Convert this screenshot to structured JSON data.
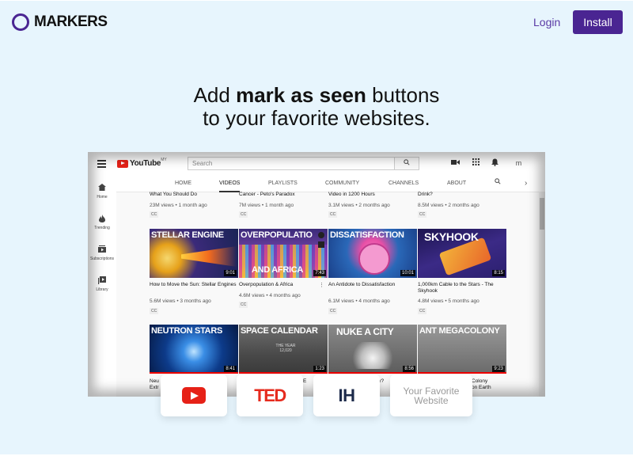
{
  "header": {
    "brand": "MARKERS",
    "login_label": "Login",
    "install_label": "Install"
  },
  "hero": {
    "line1_pre": "Add ",
    "line1_bold": "mark as seen",
    "line1_post": " buttons",
    "line2": "to your favorite websites."
  },
  "youtube": {
    "logo_text": "YouTube",
    "logo_region": "MY",
    "search_placeholder": "Search",
    "avatar_letter": "m",
    "sidebar": [
      {
        "label": "Home",
        "icon": "home-icon"
      },
      {
        "label": "Trending",
        "icon": "flame-icon"
      },
      {
        "label": "Subscriptions",
        "icon": "subscriptions-icon"
      },
      {
        "label": "Library",
        "icon": "library-icon"
      }
    ],
    "tabs": [
      "HOME",
      "VIDEOS",
      "PLAYLISTS",
      "COMMUNITY",
      "CHANNELS",
      "ABOUT"
    ],
    "active_tab": "VIDEOS",
    "top_row": [
      {
        "title": "What You Should Do",
        "meta": "23M views • 1 month ago",
        "badge": "CC"
      },
      {
        "title": "Cancer - Peto's Paradox",
        "meta": "7M views • 1 month ago",
        "badge": "CC"
      },
      {
        "title": "Video in 1200 Hours",
        "meta": "3.1M views • 2 months ago",
        "badge": "CC"
      },
      {
        "title": "Drink?",
        "meta": "8.5M views • 2 months ago",
        "badge": "CC"
      }
    ],
    "middle_row": [
      {
        "thumb_text": "STELLAR ENGINE",
        "duration": "9:01",
        "title": "How to Move the Sun: Stellar Engines",
        "meta": "5.6M views • 3 months ago",
        "badge": "CC",
        "bg": "#2b3a7a",
        "accent": "#f2a30f"
      },
      {
        "thumb_text": "OVERPOPULATIO",
        "thumb_text_2": "AND AFRICA",
        "duration": "7:43",
        "title": "Overpopulation & Africa",
        "meta": "4.6M views • 4 months ago",
        "badge": "CC",
        "bg": "#3a2a78",
        "accent": "#e14b8c"
      },
      {
        "thumb_text": "DISSATISFACTION",
        "duration": "10:01",
        "title": "An Antidote to Dissatisfaction",
        "meta": "6.1M views • 4 months ago",
        "badge": "CC",
        "bg": "#2a68b8",
        "accent": "#f07ac0"
      },
      {
        "thumb_text": "SKYHOOK",
        "duration": "8:15",
        "title": "1,000km Cable to the Stars - The Skyhook",
        "meta": "4.8M views • 5 months ago",
        "badge": "CC",
        "bg": "#2b1f6e",
        "accent": "#e8662a"
      }
    ],
    "bottom_row": [
      {
        "thumb_text": "NEUTRON STARS",
        "duration": "8:41",
        "title_fragment": "Neu",
        "title_fragment_2": "Extr",
        "bg": "#0d3b8a"
      },
      {
        "thumb_text": "SPACE CALENDAR",
        "duration": "1:23",
        "caption": "THE YEAR 12,020",
        "title_fragment": "E",
        "bg": "#555555"
      },
      {
        "thumb_text": "NUKE A CITY",
        "duration": "8:56",
        "title_fragment": "ity?",
        "bg": "#6a6a6a"
      },
      {
        "thumb_text": "ANT MEGACOLONY",
        "duration": "9:23",
        "title_fragment": "Colony",
        "title_fragment_2": "on Earth",
        "bg": "#7a7a7a"
      }
    ]
  },
  "badges": {
    "ted": "TED",
    "ih": "IH",
    "favorite": "Your Favorite Website"
  },
  "colors": {
    "brand_purple": "#4a2592",
    "page_bg": "#e7f5fd",
    "youtube_red": "#e62117",
    "ted_red": "#e62b1e"
  }
}
